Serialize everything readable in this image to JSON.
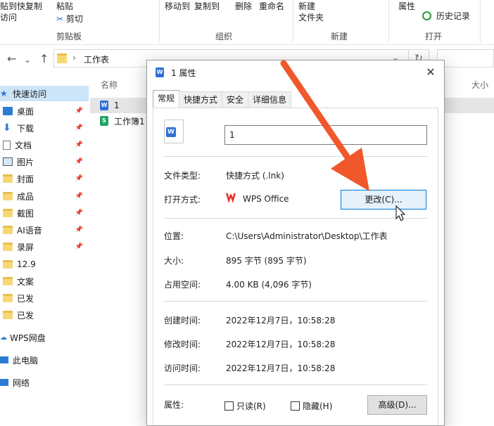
{
  "ribbon": {
    "top_fragments": [
      "贴到快",
      "复制",
      "粘贴",
      "移动到",
      "复制到",
      "删除",
      "重命名",
      "属性",
      "新建",
      "历史记录"
    ],
    "items": {
      "paste_left": "访问",
      "cut": "剪切",
      "new_folder_line1": "新建",
      "new_folder_line2": "文件夹",
      "open_line1": "属性",
      "history": "历史记录"
    },
    "groups": {
      "clipboard": "剪贴板",
      "organize": "组织",
      "new": "新建",
      "open": "打开"
    }
  },
  "address": {
    "path_separator": "›",
    "folder_name": "工作表"
  },
  "nav_pane": {
    "items": [
      {
        "label": "快速访问",
        "icon": "star-icon",
        "selected": true
      },
      {
        "label": "桌面",
        "icon": "desktop-icon",
        "pinned": true
      },
      {
        "label": "下载",
        "icon": "download-icon",
        "pinned": true
      },
      {
        "label": "文档",
        "icon": "document-icon",
        "pinned": true
      },
      {
        "label": "图片",
        "icon": "picture-icon",
        "pinned": true
      },
      {
        "label": "封面",
        "icon": "folder-icon",
        "pinned": true
      },
      {
        "label": "成品",
        "icon": "folder-icon",
        "pinned": true
      },
      {
        "label": "截图",
        "icon": "folder-icon",
        "pinned": true
      },
      {
        "label": "AI语音",
        "icon": "folder-icon",
        "pinned": true
      },
      {
        "label": "录屏",
        "icon": "folder-icon",
        "pinned": true
      },
      {
        "label": "12.9",
        "icon": "folder-icon"
      },
      {
        "label": "文案",
        "icon": "folder-icon"
      },
      {
        "label": "已发",
        "icon": "folder-icon"
      },
      {
        "label": "已发",
        "icon": "folder-icon"
      },
      {
        "label": "WPS网盘",
        "icon": "cloud-icon"
      },
      {
        "label": "此电脑",
        "icon": "computer-icon"
      },
      {
        "label": "网络",
        "icon": "network-icon"
      }
    ]
  },
  "file_list": {
    "columns": {
      "name": "名称",
      "size": "大小"
    },
    "rows": [
      {
        "name": "1",
        "type": "wps-writer",
        "selected": true
      },
      {
        "name": "工作簿1",
        "type": "wps-sheet",
        "selected": false
      }
    ]
  },
  "dialog": {
    "title": "1 属性",
    "tabs": [
      "常规",
      "快捷方式",
      "安全",
      "详细信息"
    ],
    "active_tab": "常规",
    "file_name": "1",
    "fields": {
      "file_type_label": "文件类型:",
      "file_type_value": "快捷方式 (.lnk)",
      "open_with_label": "打开方式:",
      "open_with_value": "WPS Office",
      "change_button": "更改(C)...",
      "location_label": "位置:",
      "location_value": "C:\\Users\\Administrator\\Desktop\\工作表",
      "size_label": "大小:",
      "size_value": "895 字节 (895 字节)",
      "disk_size_label": "占用空间:",
      "disk_size_value": "4.00 KB (4,096 字节)",
      "created_label": "创建时间:",
      "created_value": "2022年12月7日，10:58:28",
      "modified_label": "修改时间:",
      "modified_value": "2022年12月7日，10:58:28",
      "accessed_label": "访问时间:",
      "accessed_value": "2022年12月7日，10:58:28",
      "attributes_label": "属性:",
      "readonly_label": "只读(R)",
      "hidden_label": "隐藏(H)",
      "advanced_button": "高级(D)..."
    }
  },
  "colors": {
    "accent": "#0078d7",
    "selection": "#cce4f7",
    "annotation_arrow": "#f0582b",
    "folder": "#f8d775",
    "wps_red": "#e8332a"
  }
}
